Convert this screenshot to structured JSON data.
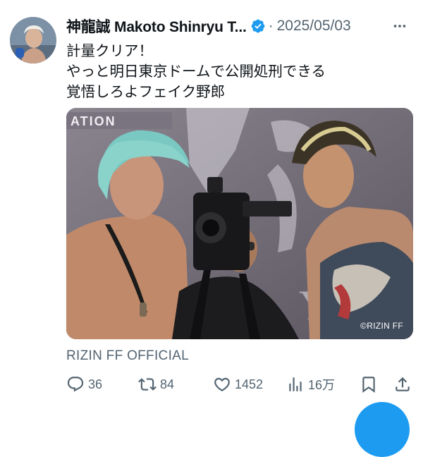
{
  "author": {
    "display_name": "神龍誠 Makoto Shinryu T...",
    "verified_badge_icon": "verified-badge-icon",
    "separator": "·",
    "date": "2025/05/03"
  },
  "tweet": {
    "lines": [
      "計量クリア！",
      "やっと明日東京ドームで公開処刑できる",
      "覚悟しろよフェイク野郎"
    ]
  },
  "media": {
    "banner_text": "ATION",
    "watermark": "©RIZIN FF"
  },
  "source_label": "RIZIN FF OFFICIAL",
  "actions": {
    "reply": {
      "icon": "reply-icon",
      "count": "36"
    },
    "repost": {
      "icon": "repost-icon",
      "count": "84"
    },
    "like": {
      "icon": "heart-icon",
      "count": "1452"
    },
    "views": {
      "icon": "analytics-icon",
      "count": "16万"
    },
    "bookmark": {
      "icon": "bookmark-icon"
    },
    "share": {
      "icon": "share-icon"
    }
  },
  "colors": {
    "text": "#0f1419",
    "secondary": "#536471",
    "accent": "#1d9bf0"
  }
}
